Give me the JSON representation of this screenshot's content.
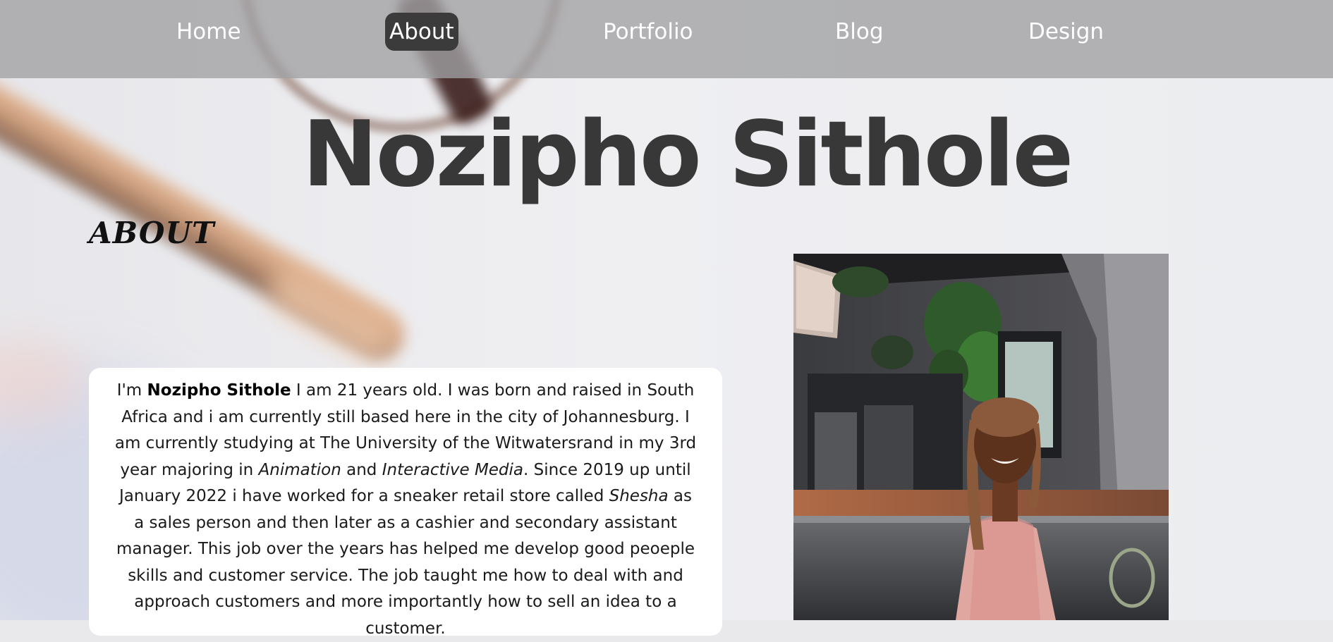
{
  "nav": {
    "items": [
      {
        "label": "Home"
      },
      {
        "label": "About",
        "active": true
      },
      {
        "label": "Portfolio"
      },
      {
        "label": "Blog"
      },
      {
        "label": "Design"
      }
    ],
    "active_bg_color": "#3b3b3b",
    "text_color": "#ffffff"
  },
  "page": {
    "title": "Nozipho Sithole",
    "section_heading": "ABOUT"
  },
  "about": {
    "p1": "I'm ",
    "name": "Nozipho Sithole",
    "p2": " I am 21 years old. I was born and raised in South Africa and i am currently still based here in the city of Johannesburg. I am currently studying at The University of the Witwatersrand in my 3rd year majoring in ",
    "major1": "Animation",
    "p3": " and ",
    "major2": "Interactive Media",
    "p4": ". Since 2019 up until January 2022 i have worked for a sneaker retail store called ",
    "store": "Shesha",
    "p5": " as a sales person and then later as a cashier and secondary assistant manager. This job over the years has helped me develop good peoeple skills and customer service. The job taught me how to deal with and approach customers and more importantly how to sell an idea to a customer."
  },
  "colors": {
    "title": "#383838",
    "card_bg": "#ffffff",
    "navbar": "#a0a0a3"
  }
}
